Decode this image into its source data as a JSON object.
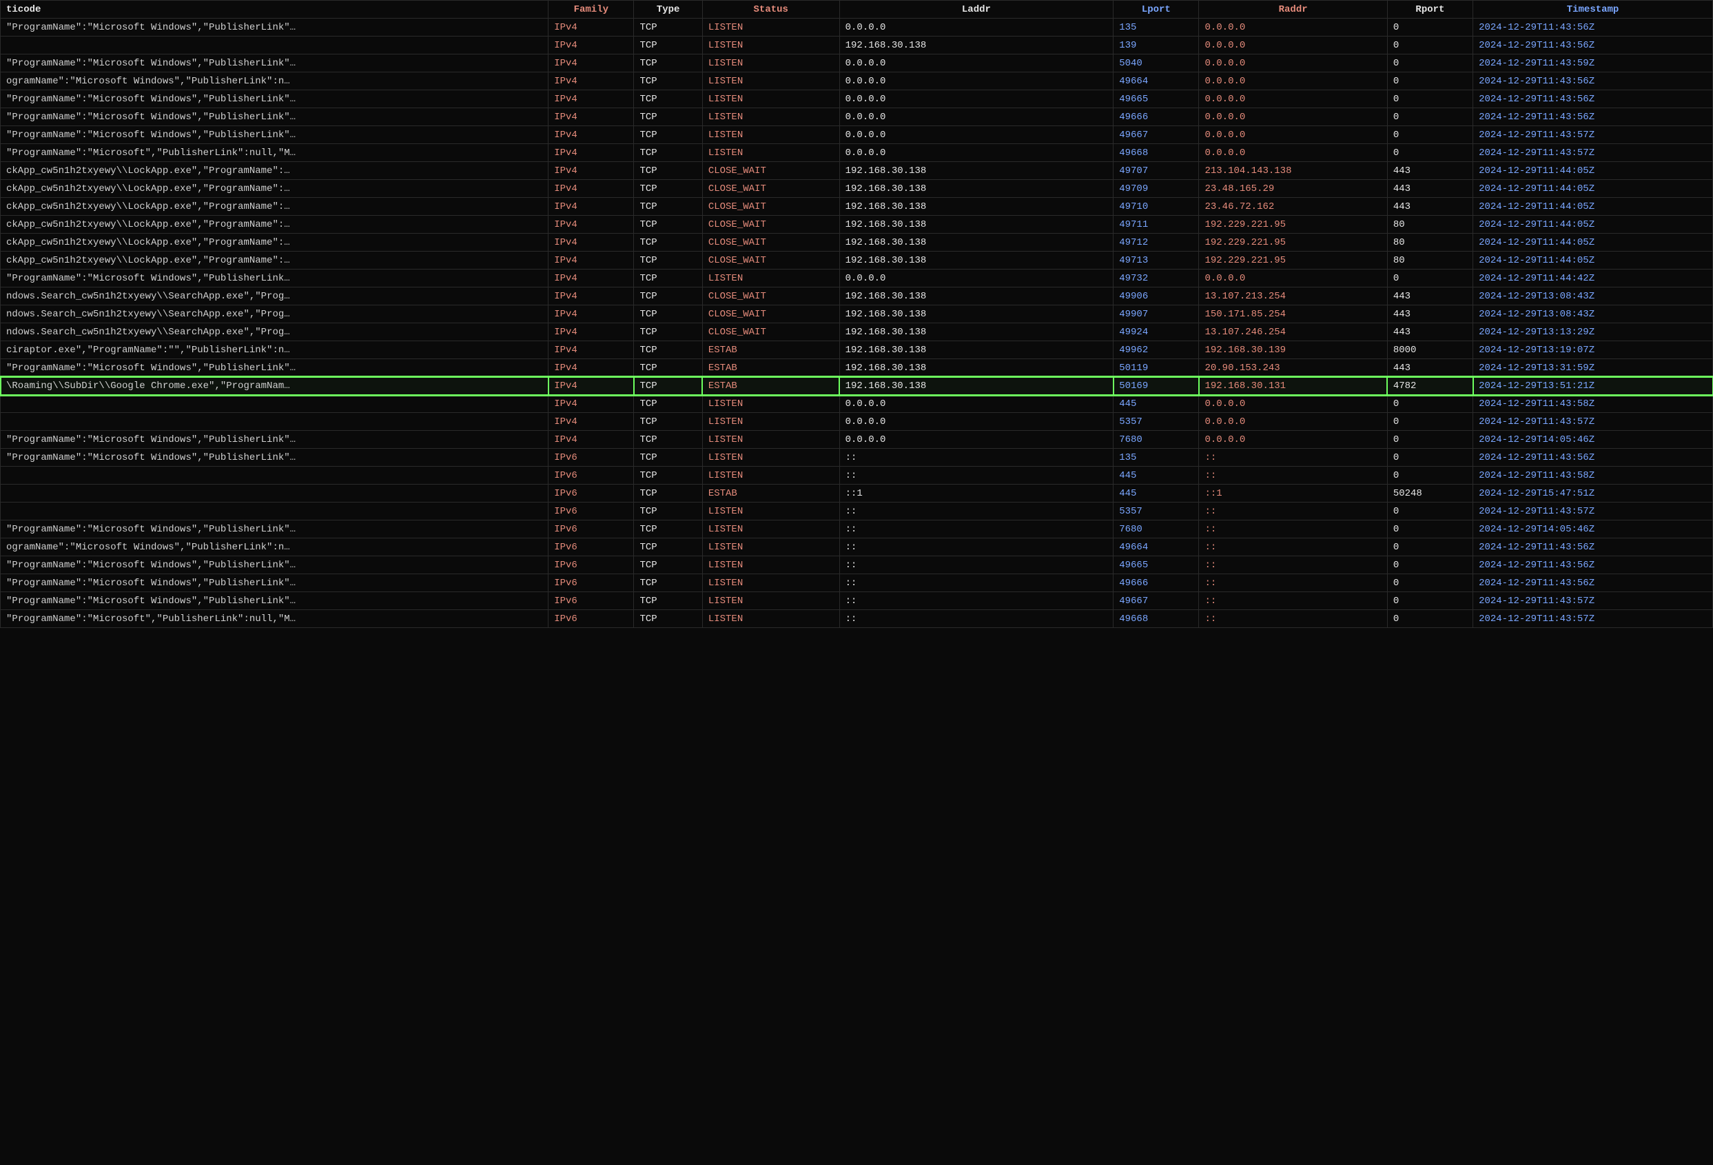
{
  "columns": {
    "code": {
      "label": "ticode"
    },
    "family": {
      "label": "Family"
    },
    "type": {
      "label": "Type"
    },
    "status": {
      "label": "Status"
    },
    "laddr": {
      "label": "Laddr"
    },
    "lport": {
      "label": "Lport"
    },
    "raddr": {
      "label": "Raddr"
    },
    "rport": {
      "label": "Rport"
    },
    "ts": {
      "label": "Timestamp"
    }
  },
  "rows": [
    {
      "code": "\"ProgramName\":\"Microsoft Windows\",\"PublisherLink\"…",
      "family": "IPv4",
      "type": "TCP",
      "status": "LISTEN",
      "laddr": "0.0.0.0",
      "lport": "135",
      "raddr": "0.0.0.0",
      "rport": "0",
      "ts": "2024-12-29T11:43:56Z",
      "hl": false
    },
    {
      "code": "",
      "family": "IPv4",
      "type": "TCP",
      "status": "LISTEN",
      "laddr": "192.168.30.138",
      "lport": "139",
      "raddr": "0.0.0.0",
      "rport": "0",
      "ts": "2024-12-29T11:43:56Z",
      "hl": false
    },
    {
      "code": "\"ProgramName\":\"Microsoft Windows\",\"PublisherLink\"…",
      "family": "IPv4",
      "type": "TCP",
      "status": "LISTEN",
      "laddr": "0.0.0.0",
      "lport": "5040",
      "raddr": "0.0.0.0",
      "rport": "0",
      "ts": "2024-12-29T11:43:59Z",
      "hl": false
    },
    {
      "code": "ogramName\":\"Microsoft Windows\",\"PublisherLink\":n…",
      "family": "IPv4",
      "type": "TCP",
      "status": "LISTEN",
      "laddr": "0.0.0.0",
      "lport": "49664",
      "raddr": "0.0.0.0",
      "rport": "0",
      "ts": "2024-12-29T11:43:56Z",
      "hl": false
    },
    {
      "code": "\"ProgramName\":\"Microsoft Windows\",\"PublisherLink\"…",
      "family": "IPv4",
      "type": "TCP",
      "status": "LISTEN",
      "laddr": "0.0.0.0",
      "lport": "49665",
      "raddr": "0.0.0.0",
      "rport": "0",
      "ts": "2024-12-29T11:43:56Z",
      "hl": false
    },
    {
      "code": "\"ProgramName\":\"Microsoft Windows\",\"PublisherLink\"…",
      "family": "IPv4",
      "type": "TCP",
      "status": "LISTEN",
      "laddr": "0.0.0.0",
      "lport": "49666",
      "raddr": "0.0.0.0",
      "rport": "0",
      "ts": "2024-12-29T11:43:56Z",
      "hl": false
    },
    {
      "code": "\"ProgramName\":\"Microsoft Windows\",\"PublisherLink\"…",
      "family": "IPv4",
      "type": "TCP",
      "status": "LISTEN",
      "laddr": "0.0.0.0",
      "lport": "49667",
      "raddr": "0.0.0.0",
      "rport": "0",
      "ts": "2024-12-29T11:43:57Z",
      "hl": false
    },
    {
      "code": "\"ProgramName\":\"Microsoft\",\"PublisherLink\":null,\"M…",
      "family": "IPv4",
      "type": "TCP",
      "status": "LISTEN",
      "laddr": "0.0.0.0",
      "lport": "49668",
      "raddr": "0.0.0.0",
      "rport": "0",
      "ts": "2024-12-29T11:43:57Z",
      "hl": false
    },
    {
      "code": "ckApp_cw5n1h2txyewy\\\\LockApp.exe\",\"ProgramName\":…",
      "family": "IPv4",
      "type": "TCP",
      "status": "CLOSE_WAIT",
      "laddr": "192.168.30.138",
      "lport": "49707",
      "raddr": "213.104.143.138",
      "rport": "443",
      "ts": "2024-12-29T11:44:05Z",
      "hl": false
    },
    {
      "code": "ckApp_cw5n1h2txyewy\\\\LockApp.exe\",\"ProgramName\":…",
      "family": "IPv4",
      "type": "TCP",
      "status": "CLOSE_WAIT",
      "laddr": "192.168.30.138",
      "lport": "49709",
      "raddr": "23.48.165.29",
      "rport": "443",
      "ts": "2024-12-29T11:44:05Z",
      "hl": false
    },
    {
      "code": "ckApp_cw5n1h2txyewy\\\\LockApp.exe\",\"ProgramName\":…",
      "family": "IPv4",
      "type": "TCP",
      "status": "CLOSE_WAIT",
      "laddr": "192.168.30.138",
      "lport": "49710",
      "raddr": "23.46.72.162",
      "rport": "443",
      "ts": "2024-12-29T11:44:05Z",
      "hl": false
    },
    {
      "code": "ckApp_cw5n1h2txyewy\\\\LockApp.exe\",\"ProgramName\":…",
      "family": "IPv4",
      "type": "TCP",
      "status": "CLOSE_WAIT",
      "laddr": "192.168.30.138",
      "lport": "49711",
      "raddr": "192.229.221.95",
      "rport": "80",
      "ts": "2024-12-29T11:44:05Z",
      "hl": false
    },
    {
      "code": "ckApp_cw5n1h2txyewy\\\\LockApp.exe\",\"ProgramName\":…",
      "family": "IPv4",
      "type": "TCP",
      "status": "CLOSE_WAIT",
      "laddr": "192.168.30.138",
      "lport": "49712",
      "raddr": "192.229.221.95",
      "rport": "80",
      "ts": "2024-12-29T11:44:05Z",
      "hl": false
    },
    {
      "code": "ckApp_cw5n1h2txyewy\\\\LockApp.exe\",\"ProgramName\":…",
      "family": "IPv4",
      "type": "TCP",
      "status": "CLOSE_WAIT",
      "laddr": "192.168.30.138",
      "lport": "49713",
      "raddr": "192.229.221.95",
      "rport": "80",
      "ts": "2024-12-29T11:44:05Z",
      "hl": false
    },
    {
      "code": "\"ProgramName\":\"Microsoft Windows\",\"PublisherLink…",
      "family": "IPv4",
      "type": "TCP",
      "status": "LISTEN",
      "laddr": "0.0.0.0",
      "lport": "49732",
      "raddr": "0.0.0.0",
      "rport": "0",
      "ts": "2024-12-29T11:44:42Z",
      "hl": false
    },
    {
      "code": "ndows.Search_cw5n1h2txyewy\\\\SearchApp.exe\",\"Prog…",
      "family": "IPv4",
      "type": "TCP",
      "status": "CLOSE_WAIT",
      "laddr": "192.168.30.138",
      "lport": "49906",
      "raddr": "13.107.213.254",
      "rport": "443",
      "ts": "2024-12-29T13:08:43Z",
      "hl": false
    },
    {
      "code": "ndows.Search_cw5n1h2txyewy\\\\SearchApp.exe\",\"Prog…",
      "family": "IPv4",
      "type": "TCP",
      "status": "CLOSE_WAIT",
      "laddr": "192.168.30.138",
      "lport": "49907",
      "raddr": "150.171.85.254",
      "rport": "443",
      "ts": "2024-12-29T13:08:43Z",
      "hl": false
    },
    {
      "code": "ndows.Search_cw5n1h2txyewy\\\\SearchApp.exe\",\"Prog…",
      "family": "IPv4",
      "type": "TCP",
      "status": "CLOSE_WAIT",
      "laddr": "192.168.30.138",
      "lport": "49924",
      "raddr": "13.107.246.254",
      "rport": "443",
      "ts": "2024-12-29T13:13:29Z",
      "hl": false
    },
    {
      "code": "ciraptor.exe\",\"ProgramName\":\"\",\"PublisherLink\":n…",
      "family": "IPv4",
      "type": "TCP",
      "status": "ESTAB",
      "laddr": "192.168.30.138",
      "lport": "49962",
      "raddr": "192.168.30.139",
      "rport": "8000",
      "ts": "2024-12-29T13:19:07Z",
      "hl": false
    },
    {
      "code": "\"ProgramName\":\"Microsoft Windows\",\"PublisherLink\"…",
      "family": "IPv4",
      "type": "TCP",
      "status": "ESTAB",
      "laddr": "192.168.30.138",
      "lport": "50119",
      "raddr": "20.90.153.243",
      "rport": "443",
      "ts": "2024-12-29T13:31:59Z",
      "hl": false
    },
    {
      "code": "\\Roaming\\\\SubDir\\\\Google Chrome.exe\",\"ProgramNam…",
      "family": "IPv4",
      "type": "TCP",
      "status": "ESTAB",
      "laddr": "192.168.30.138",
      "lport": "50169",
      "raddr": "192.168.30.131",
      "rport": "4782",
      "ts": "2024-12-29T13:51:21Z",
      "hl": true
    },
    {
      "code": "",
      "family": "IPv4",
      "type": "TCP",
      "status": "LISTEN",
      "laddr": "0.0.0.0",
      "lport": "445",
      "raddr": "0.0.0.0",
      "rport": "0",
      "ts": "2024-12-29T11:43:58Z",
      "hl": false
    },
    {
      "code": "",
      "family": "IPv4",
      "type": "TCP",
      "status": "LISTEN",
      "laddr": "0.0.0.0",
      "lport": "5357",
      "raddr": "0.0.0.0",
      "rport": "0",
      "ts": "2024-12-29T11:43:57Z",
      "hl": false
    },
    {
      "code": "\"ProgramName\":\"Microsoft Windows\",\"PublisherLink\"…",
      "family": "IPv4",
      "type": "TCP",
      "status": "LISTEN",
      "laddr": "0.0.0.0",
      "lport": "7680",
      "raddr": "0.0.0.0",
      "rport": "0",
      "ts": "2024-12-29T14:05:46Z",
      "hl": false
    },
    {
      "code": "\"ProgramName\":\"Microsoft Windows\",\"PublisherLink\"…",
      "family": "IPv6",
      "type": "TCP",
      "status": "LISTEN",
      "laddr": "::",
      "lport": "135",
      "raddr": "::",
      "rport": "0",
      "ts": "2024-12-29T11:43:56Z",
      "hl": false
    },
    {
      "code": "",
      "family": "IPv6",
      "type": "TCP",
      "status": "LISTEN",
      "laddr": "::",
      "lport": "445",
      "raddr": "::",
      "rport": "0",
      "ts": "2024-12-29T11:43:58Z",
      "hl": false
    },
    {
      "code": "",
      "family": "IPv6",
      "type": "TCP",
      "status": "ESTAB",
      "laddr": "::1",
      "lport": "445",
      "raddr": "::1",
      "rport": "50248",
      "ts": "2024-12-29T15:47:51Z",
      "hl": false
    },
    {
      "code": "",
      "family": "IPv6",
      "type": "TCP",
      "status": "LISTEN",
      "laddr": "::",
      "lport": "5357",
      "raddr": "::",
      "rport": "0",
      "ts": "2024-12-29T11:43:57Z",
      "hl": false
    },
    {
      "code": "\"ProgramName\":\"Microsoft Windows\",\"PublisherLink\"…",
      "family": "IPv6",
      "type": "TCP",
      "status": "LISTEN",
      "laddr": "::",
      "lport": "7680",
      "raddr": "::",
      "rport": "0",
      "ts": "2024-12-29T14:05:46Z",
      "hl": false
    },
    {
      "code": "ogramName\":\"Microsoft Windows\",\"PublisherLink\":n…",
      "family": "IPv6",
      "type": "TCP",
      "status": "LISTEN",
      "laddr": "::",
      "lport": "49664",
      "raddr": "::",
      "rport": "0",
      "ts": "2024-12-29T11:43:56Z",
      "hl": false
    },
    {
      "code": "\"ProgramName\":\"Microsoft Windows\",\"PublisherLink\"…",
      "family": "IPv6",
      "type": "TCP",
      "status": "LISTEN",
      "laddr": "::",
      "lport": "49665",
      "raddr": "::",
      "rport": "0",
      "ts": "2024-12-29T11:43:56Z",
      "hl": false
    },
    {
      "code": "\"ProgramName\":\"Microsoft Windows\",\"PublisherLink\"…",
      "family": "IPv6",
      "type": "TCP",
      "status": "LISTEN",
      "laddr": "::",
      "lport": "49666",
      "raddr": "::",
      "rport": "0",
      "ts": "2024-12-29T11:43:56Z",
      "hl": false
    },
    {
      "code": "\"ProgramName\":\"Microsoft Windows\",\"PublisherLink\"…",
      "family": "IPv6",
      "type": "TCP",
      "status": "LISTEN",
      "laddr": "::",
      "lport": "49667",
      "raddr": "::",
      "rport": "0",
      "ts": "2024-12-29T11:43:57Z",
      "hl": false
    },
    {
      "code": "\"ProgramName\":\"Microsoft\",\"PublisherLink\":null,\"M…",
      "family": "IPv6",
      "type": "TCP",
      "status": "LISTEN",
      "laddr": "::",
      "lport": "49668",
      "raddr": "::",
      "rport": "0",
      "ts": "2024-12-29T11:43:57Z",
      "hl": false
    }
  ]
}
